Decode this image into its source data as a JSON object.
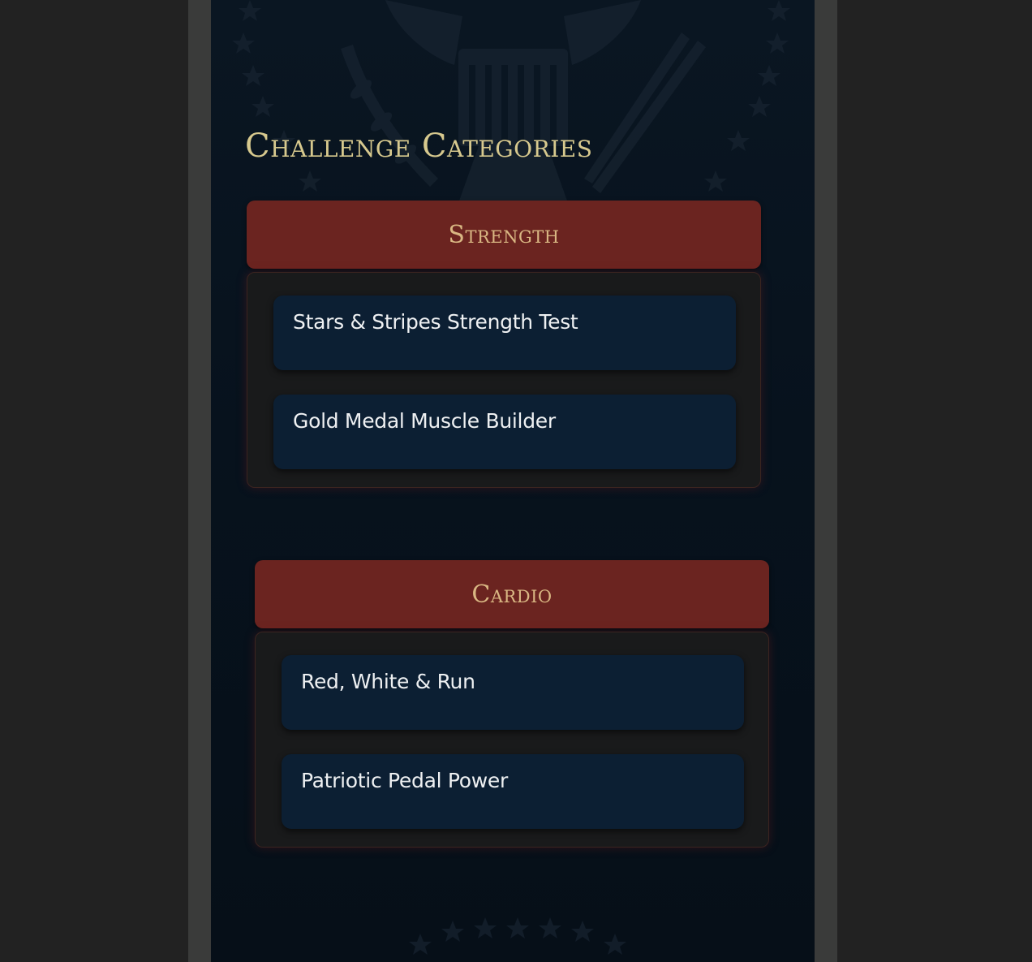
{
  "page": {
    "heading": "Challenge Categories"
  },
  "categories": [
    {
      "title": "Strength",
      "challenges": [
        "Stars & Stripes Strength Test",
        "Gold Medal Muscle Builder"
      ]
    },
    {
      "title": "Cardio",
      "challenges": [
        "Red, White & Run",
        "Patriotic Pedal Power"
      ]
    }
  ],
  "colors": {
    "background": "#07121d",
    "header_red": "#6b2420",
    "header_text": "#d9b783",
    "heading_gold": "#d7c98e",
    "card_blue": "#0c1f33"
  },
  "icons": {
    "seal": "eagle-seal-watermark",
    "stars": "star-row-decoration"
  }
}
